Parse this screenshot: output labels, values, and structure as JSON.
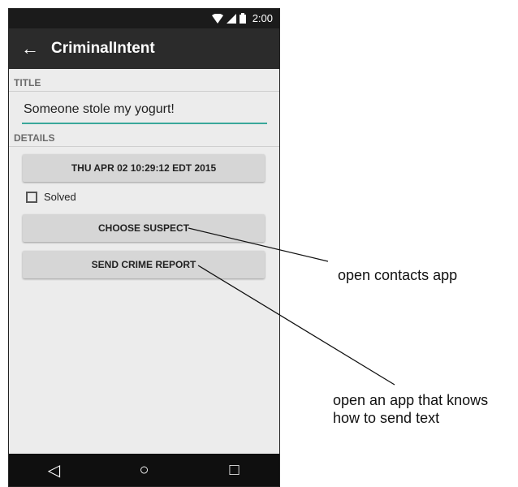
{
  "status_bar": {
    "time": "2:00",
    "icons": [
      "wifi-icon",
      "signal-icon",
      "battery-icon"
    ]
  },
  "app_bar": {
    "back_icon": "back-arrow-icon",
    "title": "CriminalIntent"
  },
  "title_section": {
    "header": "TITLE",
    "value": "Someone stole my yogurt!"
  },
  "details_section": {
    "header": "DETAILS",
    "date_button": "THU APR 02 10:29:12 EDT 2015",
    "solved_label": "Solved",
    "solved_checked": false,
    "choose_suspect_button": "CHOOSE SUSPECT",
    "send_report_button": "SEND CRIME REPORT"
  },
  "nav_bar": {
    "icons": [
      "back-triangle-icon",
      "home-circle-icon",
      "recents-square-icon"
    ]
  },
  "annotations": {
    "contacts": "open contacts app",
    "send_text_line1": "open an app that knows",
    "send_text_line2": "how to send text"
  },
  "colors": {
    "accent": "#3aa89a",
    "app_bar": "#2b2b2b",
    "status_bar": "#1b1b1b",
    "screen_bg": "#ececec"
  }
}
